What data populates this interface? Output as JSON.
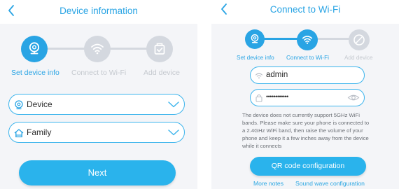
{
  "colors": {
    "accent": "#29a4e4",
    "button": "#2ab3ec",
    "inactive_step": "#d4d8df",
    "background": "#f4f5f8"
  },
  "left": {
    "header": {
      "title": "Device information",
      "back_icon": "chevron-left-icon"
    },
    "steps": [
      {
        "label": "Set device info",
        "icon": "camera-icon",
        "state": "active"
      },
      {
        "label": "Connect to Wi-Fi",
        "icon": "wifi-icon",
        "state": "inactive"
      },
      {
        "label": "Add device",
        "icon": "device-check-icon",
        "state": "inactive"
      }
    ],
    "fields": [
      {
        "value": "Device",
        "icon": "camera-pin-icon",
        "control_icon": "chevron-down-icon"
      },
      {
        "value": "Family",
        "icon": "home-icon",
        "control_icon": "chevron-down-icon"
      }
    ],
    "next_button": "Next"
  },
  "right": {
    "header": {
      "title": "Connect to Wi-Fi",
      "back_icon": "chevron-left-icon"
    },
    "steps": [
      {
        "label": "Set device info",
        "icon": "camera-icon",
        "state": "active"
      },
      {
        "label": "Connect to Wi-Fi",
        "icon": "wifi-icon",
        "state": "active"
      },
      {
        "label": "Add device",
        "icon": "device-check-icon",
        "state": "inactive"
      }
    ],
    "ssid": {
      "value": "admin",
      "icon": "wifi-icon"
    },
    "password": {
      "value": "••••••••••••",
      "icon": "lock-icon",
      "toggle_icon": "eye-icon"
    },
    "notice": "The device does not currently support 5GHz WiFi bands. Please make sure your phone is connected to a 2.4GHz WiFi band, then raise the volume of your phone and keep it a few inches away from the device while it connects",
    "qr_button": "QR code configuration",
    "links": {
      "more_notes": "More notes",
      "sound_wave": "Sound wave configuration"
    }
  }
}
